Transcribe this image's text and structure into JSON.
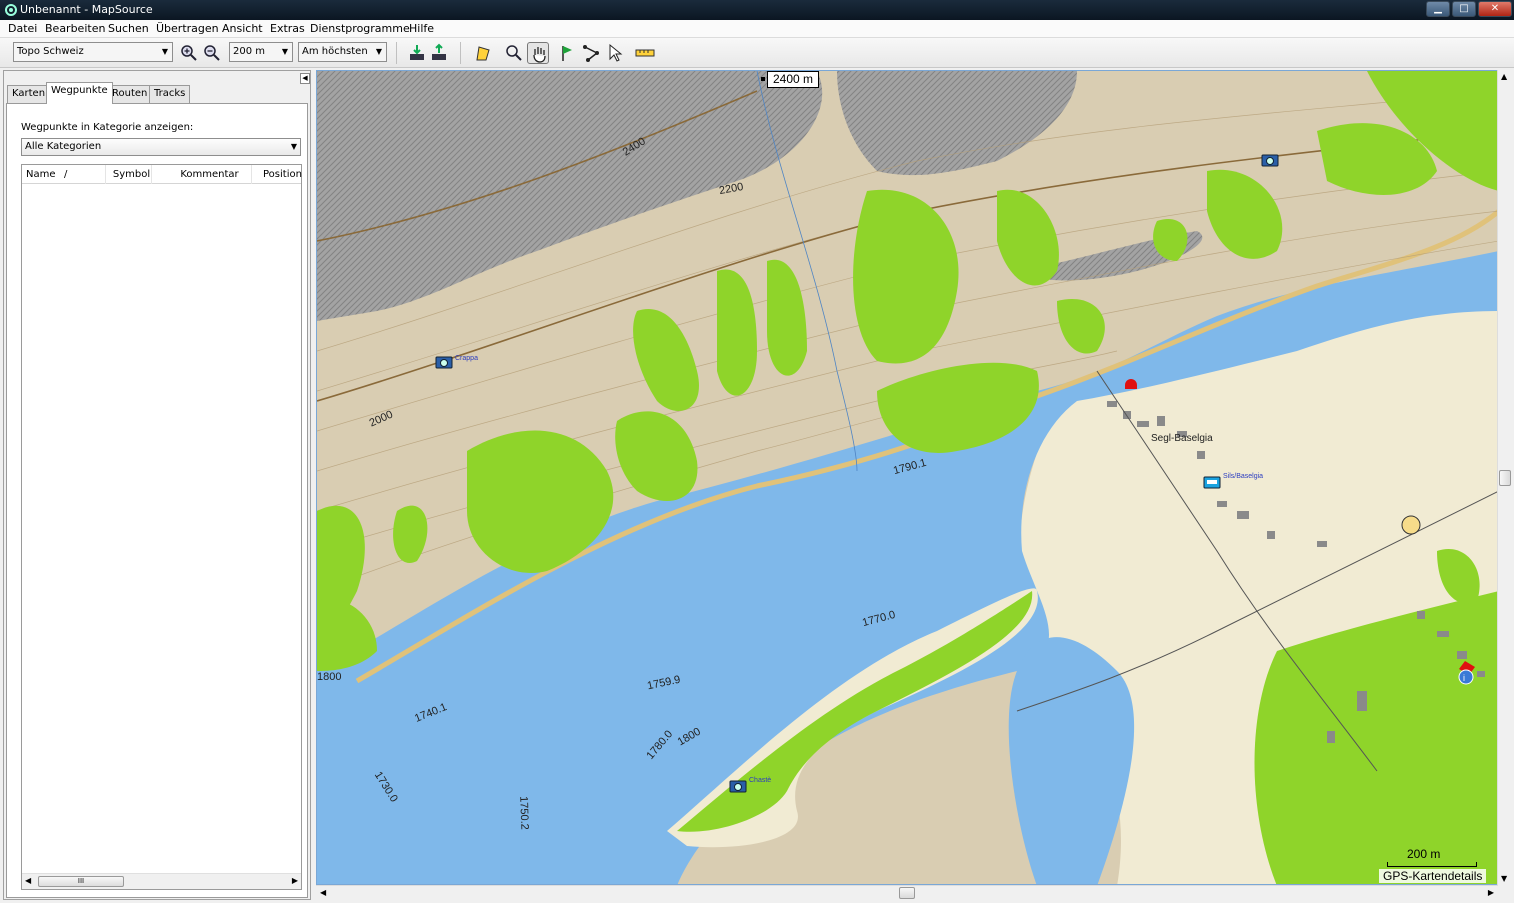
{
  "window": {
    "title": "Unbenannt - MapSource",
    "minimize": "▁",
    "maximize": "□",
    "close": "✕"
  },
  "menu": [
    "Datei",
    "Bearbeiten",
    "Suchen",
    "Übertragen",
    "Ansicht",
    "Extras",
    "Dienstprogramme",
    "Hilfe"
  ],
  "toolbar": {
    "map_product": "Topo Schweiz",
    "zoom_level": "200 m",
    "detail_level": "Am höchsten",
    "icons": [
      "zoom-in-icon",
      "zoom-out-icon",
      "receive-from-device-icon",
      "send-to-device-icon",
      "map-tool-icon",
      "zoom-tool-icon",
      "hand-tool-icon",
      "waypoint-tool-icon",
      "route-tool-icon",
      "selection-tool-icon",
      "distance-tool-icon"
    ]
  },
  "left_panel": {
    "tabs": [
      "Karten",
      "Wegpunkte",
      "Routen",
      "Tracks"
    ],
    "active_tab": "Wegpunkte",
    "category_label": "Wegpunkte in Kategorie anzeigen:",
    "category_value": "Alle Kategorien",
    "columns": [
      "Name",
      "Symbol",
      "Kommentar",
      "Position"
    ],
    "sort_indicator": "/",
    "scroll_thumb_grip": "III"
  },
  "map": {
    "cursor_elevation": "2400 m",
    "contour_labels": [
      "2400",
      "2200",
      "2000",
      "1800",
      "1790.1",
      "1770.0",
      "1759.9",
      "1740.1",
      "1730.0",
      "1750.2",
      "1780.0",
      "1800"
    ],
    "place_names": [
      "Segl-Baselgia"
    ],
    "poi_labels": [
      "Crappa",
      "Sils/Baselgia",
      "Chastè"
    ],
    "scale": "200 m",
    "details_label": "GPS-Kartendetails",
    "colors": {
      "lake": "#7fb8ea",
      "land": "#d9cdb2",
      "forest": "#8fd42a",
      "rock": "#9a9a9a",
      "flat": "#f1ebd3",
      "road": "#e0c27a"
    }
  }
}
